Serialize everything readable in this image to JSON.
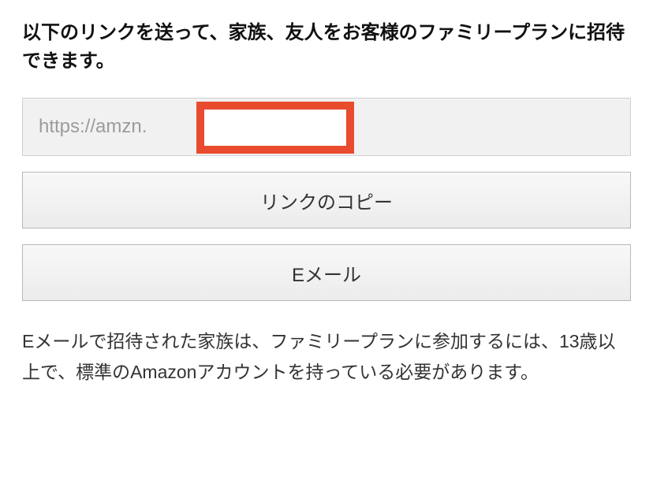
{
  "heading": "以下のリンクを送って、家族、友人をお客様のファミリープランに招待できます。",
  "link_field": {
    "display_value": "https://amzn."
  },
  "buttons": {
    "copy_link": "リンクのコピー",
    "email": "Eメール"
  },
  "footer_text": "Eメールで招待された家族は、ファミリープランに参加するには、13歳以上で、標準のAmazonアカウントを持っている必要があります。"
}
